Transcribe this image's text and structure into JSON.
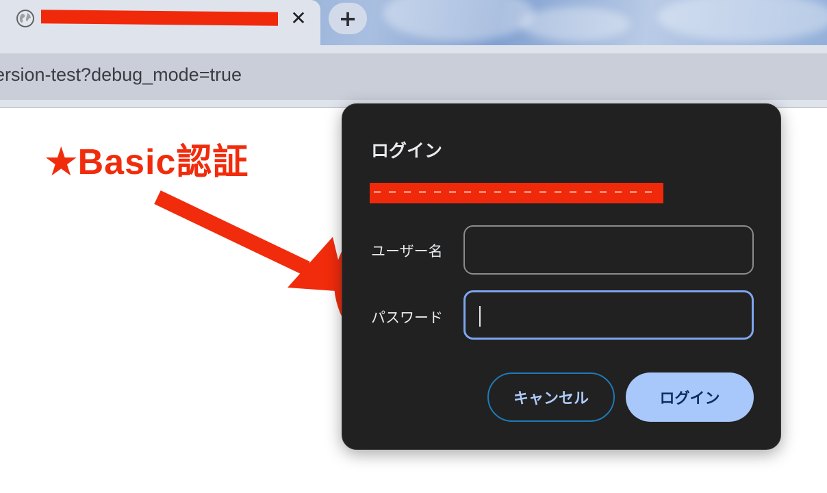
{
  "browser": {
    "tab": {
      "favicon": "globe-icon",
      "close_glyph": "✕",
      "title_redacted": true
    },
    "new_tab_glyph": "+",
    "url": "ersion-test?debug_mode=true"
  },
  "annotation": {
    "label": "★Basic認証",
    "color": "#f12c0c"
  },
  "dialog": {
    "title": "ログイン",
    "origin_redacted": true,
    "username_label": "ユーザー名",
    "username_value": "",
    "password_label": "パスワード",
    "password_value": "",
    "cancel_label": "キャンセル",
    "login_label": "ログイン"
  },
  "colors": {
    "dialog_bg": "#212121",
    "accent": "#a8c7fa",
    "focus": "#7fa6f0",
    "redaction": "#f0290b"
  }
}
